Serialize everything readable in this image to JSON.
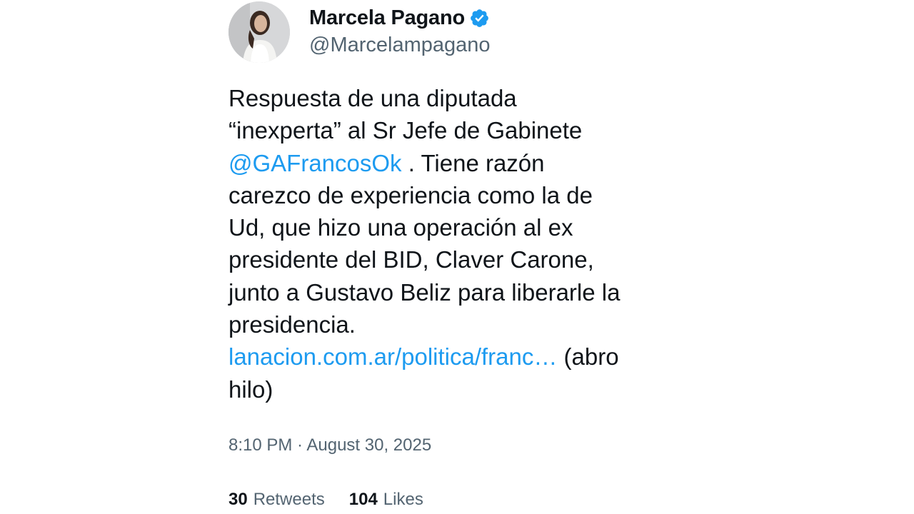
{
  "author": {
    "display_name": "Marcela Pagano",
    "handle": "@Marcelampagano",
    "verified_icon": "verified-badge-icon",
    "avatar": "profile-photo"
  },
  "tweet": {
    "text_part1": "Respuesta de una diputada\n“inexperta” al Sr Jefe de Gabinete\n",
    "mention": "@GAFrancosOk",
    "text_part2": " . Tiene razón\ncarezco de experiencia como la de\nUd, que hizo una operación al ex\npresidente del BID, Claver Carone,\njunto a Gustavo Beliz para liberarle la\npresidencia.\n",
    "link": "lanacion.com.ar/politica/franc…",
    "text_part3": " (abro\nhilo)"
  },
  "meta": {
    "timestamp": "8:10 PM · August 30, 2025"
  },
  "stats": {
    "retweets_count": "30",
    "retweets_label": "Retweets",
    "likes_count": "104",
    "likes_label": "Likes"
  },
  "colors": {
    "accent": "#1d9bf0",
    "text": "#0f1419",
    "secondary": "#536471"
  }
}
